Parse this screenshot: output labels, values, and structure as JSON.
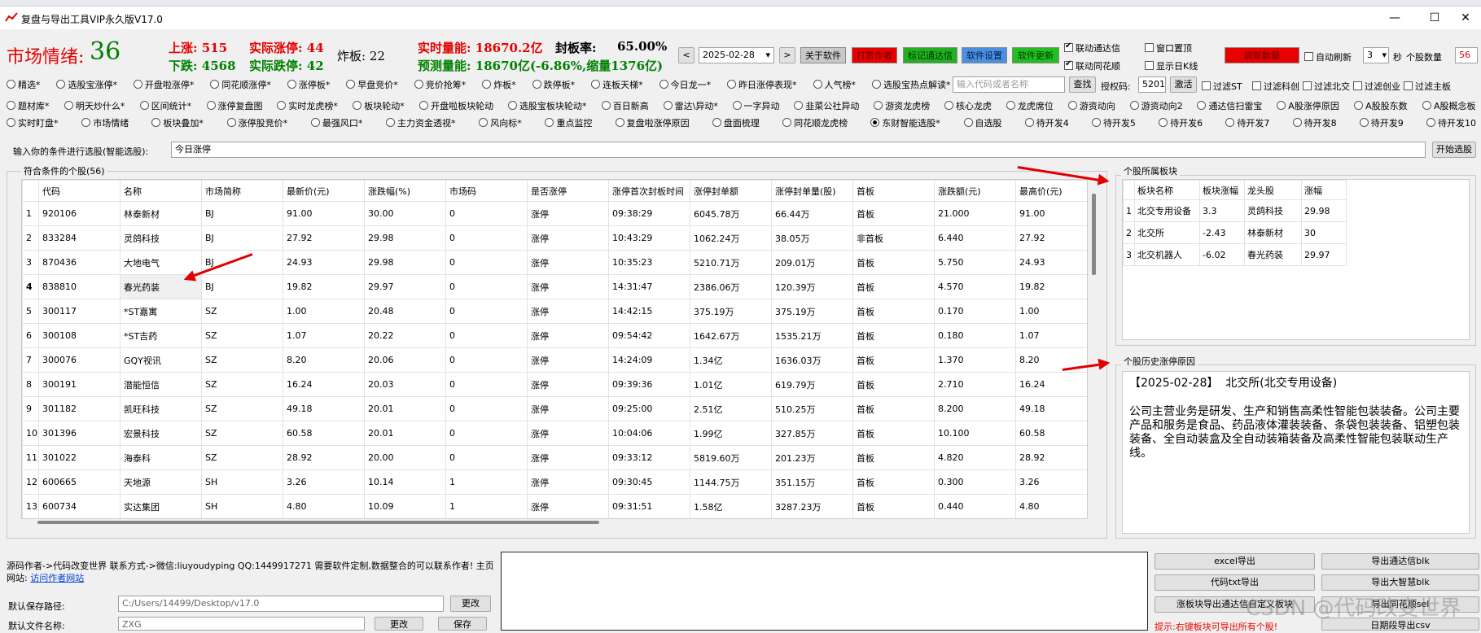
{
  "window": {
    "title": "复盘与导出工具VIP永久版V17.0",
    "minimize": "—",
    "maximize": "☐",
    "close": "✕"
  },
  "stats": {
    "mood_label": "市场情绪:",
    "mood_value": "36",
    "up": "上涨: 515",
    "real_limit_up": "实际涨停: 44",
    "broken": "炸板: 22",
    "realtime_vol": "实时量能: 18670.2亿",
    "seal_rate_label": "封板率:",
    "seal_rate": "65.00%",
    "down": "下跌: 4568",
    "real_limit_down": "实际跌停: 42",
    "forecast_vol": "预测量能: 18670亿(-6.86%,缩量1376亿)"
  },
  "toolbar": {
    "prev": "<",
    "date": "2025-02-28",
    "next": ">",
    "about": "关于软件",
    "donate": "打赏作者",
    "mark_tdx": "标记通达信",
    "settings": "软件设置",
    "update": "软件更新",
    "link_tdx": "联动通达信",
    "link_ths": "联动同花顺",
    "pin_window": "窗口置顶",
    "show_kline": "显示日K线",
    "refresh": "刷新数据",
    "auto_refresh": "自动刷新",
    "interval": "3",
    "seconds": "秒",
    "stock_count_label": "个股数量",
    "stock_count": "56"
  },
  "radio_rows": [
    [
      "精选*",
      "选股宝涨停*",
      "开盘啦涨停*",
      "同花顺涨停*",
      "涨停板*",
      "早盘竞价*",
      "竞价抢筹*",
      "炸板*",
      "跌停板*",
      "连板天梯*",
      "今日龙一*",
      "昨日涨停表现*",
      "人气榜*",
      "选股宝热点解读*"
    ],
    [
      "题材库*",
      "明天炒什么*",
      "区间统计*",
      "涨停复盘图",
      "实时龙虎榜*",
      "板块轮动*",
      "开盘啦板块轮动",
      "选股宝板块轮动*",
      "百日新高",
      "雷达\\异动*",
      "一字异动",
      "韭菜公社异动",
      "游资龙虎榜",
      "核心龙虎",
      "龙虎席位",
      "游资动向",
      "游资动向2",
      "通达信扫雷宝",
      "A股涨停原因",
      "A股股东数",
      "A股概念板"
    ],
    [
      "实时盯盘*",
      "市场情绪",
      "板块叠加*",
      "涨停股竞价*",
      "最强风口*",
      "主力资金透视*",
      "风向标*",
      "重点监控",
      "复盘啦涨停原因",
      "盘面梳理",
      "同花顺龙虎榜",
      "东财智能选股*",
      "自选股",
      "待开发4",
      "待开发5",
      "待开发6",
      "待开发7",
      "待开发8",
      "待开发9",
      "待开发10"
    ]
  ],
  "search": {
    "placeholder": "输入代码或者名称",
    "button": "查找",
    "auth_label": "授权码:",
    "auth_code": "5201",
    "activate": "激活",
    "filters": [
      "过滤ST",
      "过滤科创",
      "过滤北交",
      "过滤创业",
      "过滤主板"
    ]
  },
  "condition": {
    "label": "输入你的条件进行选股(智能选股):",
    "value": "今日涨停",
    "button": "开始选股"
  },
  "main_table": {
    "title": "符合条件的个股(56)",
    "headers": [
      "代码",
      "名称",
      "市场简称",
      "最新价(元)",
      "涨跌幅(%)",
      "市场码",
      "是否涨停",
      "涨停首次封板时间",
      "涨停封单额",
      "涨停封单量(股)",
      "首板",
      "涨跌额(元)",
      "最高价(元)"
    ],
    "rows": [
      [
        "1",
        "920106",
        "林泰新材",
        "BJ",
        "91.00",
        "30.00",
        "0",
        "涨停",
        "09:38:29",
        "6045.78万",
        "66.44万",
        "首板",
        "21.000",
        "91.00"
      ],
      [
        "2",
        "833284",
        "灵鸽科技",
        "BJ",
        "27.92",
        "29.98",
        "0",
        "涨停",
        "10:43:29",
        "1062.24万",
        "38.05万",
        "非首板",
        "6.440",
        "27.92"
      ],
      [
        "3",
        "870436",
        "大地电气",
        "BJ",
        "24.93",
        "29.98",
        "0",
        "涨停",
        "10:35:23",
        "5210.71万",
        "209.01万",
        "首板",
        "5.750",
        "24.93"
      ],
      [
        "4",
        "838810",
        "春光药装",
        "BJ",
        "19.82",
        "29.97",
        "0",
        "涨停",
        "14:31:47",
        "2386.06万",
        "120.39万",
        "首板",
        "4.570",
        "19.82"
      ],
      [
        "5",
        "300117",
        "*ST嘉寓",
        "SZ",
        "1.00",
        "20.48",
        "0",
        "涨停",
        "14:42:15",
        "375.19万",
        "375.19万",
        "首板",
        "0.170",
        "1.00"
      ],
      [
        "6",
        "300108",
        "*ST吉药",
        "SZ",
        "1.07",
        "20.22",
        "0",
        "涨停",
        "09:54:42",
        "1642.67万",
        "1535.21万",
        "首板",
        "0.180",
        "1.07"
      ],
      [
        "7",
        "300076",
        "GQY视讯",
        "SZ",
        "8.20",
        "20.06",
        "0",
        "涨停",
        "14:24:09",
        "1.34亿",
        "1636.03万",
        "首板",
        "1.370",
        "8.20"
      ],
      [
        "8",
        "300191",
        "潜能恒信",
        "SZ",
        "16.24",
        "20.03",
        "0",
        "涨停",
        "09:39:36",
        "1.01亿",
        "619.79万",
        "首板",
        "2.710",
        "16.24"
      ],
      [
        "9",
        "301182",
        "凯旺科技",
        "SZ",
        "49.18",
        "20.01",
        "0",
        "涨停",
        "09:25:00",
        "2.51亿",
        "510.25万",
        "首板",
        "8.200",
        "49.18"
      ],
      [
        "10",
        "301396",
        "宏景科技",
        "SZ",
        "60.58",
        "20.01",
        "0",
        "涨停",
        "10:04:06",
        "1.99亿",
        "327.85万",
        "首板",
        "10.100",
        "60.58"
      ],
      [
        "11",
        "301022",
        "海泰科",
        "SZ",
        "28.92",
        "20.00",
        "0",
        "涨停",
        "09:33:12",
        "5819.60万",
        "201.23万",
        "首板",
        "4.820",
        "28.92"
      ],
      [
        "12",
        "600665",
        "天地源",
        "SH",
        "3.26",
        "10.14",
        "1",
        "涨停",
        "09:30:45",
        "1144.75万",
        "351.15万",
        "首板",
        "0.300",
        "3.26"
      ],
      [
        "13",
        "600734",
        "实达集团",
        "SH",
        "4.80",
        "10.09",
        "1",
        "涨停",
        "09:31:51",
        "1.58亿",
        "3287.23万",
        "首板",
        "0.440",
        "4.80"
      ]
    ]
  },
  "sector_table": {
    "title": "个股所属板块",
    "headers": [
      "板块名称",
      "板块涨幅",
      "龙头股",
      "涨幅"
    ],
    "rows": [
      [
        "1",
        "北交专用设备",
        "3.3",
        "灵鸽科技",
        "29.98"
      ],
      [
        "2",
        "北交所",
        "-2.43",
        "林泰新材",
        "30"
      ],
      [
        "3",
        "北交机器人",
        "-6.02",
        "春光药装",
        "29.97"
      ]
    ]
  },
  "history": {
    "title": "个股历史涨停原因",
    "line1": "【2025-02-28】  北交所(北交专用设备)",
    "para": "公司主营业务是研发、生产和销售高柔性智能包装装备。公司主要产品和服务是食品、药品液体灌装装备、条袋包装装备、铝塑包装装备、全自动装盒及全自动装箱装备及高柔性智能包装联动生产线。"
  },
  "footer": {
    "author": "源码作者->代码改变世界 联系方式->微信:liuyoudyping QQ:1449917271 需要软件定制,数据整合的可以联系作者! 主页网站:",
    "site_link": "访问作者网站",
    "save_path_label": "默认保存路径:",
    "save_path": "C:/Users/14499/Desktop/v17.0",
    "change": "更改",
    "file_name_label": "默认文件名称:",
    "file_name": "ZXG",
    "change2": "更改",
    "save": "保存",
    "export": [
      "excel导出",
      "导出通达信blk",
      "代码txt导出",
      "导出大智慧blk",
      "涨板块导出通达信自定义板块",
      "导出同花顺sel",
      "日期段导出csv"
    ],
    "tip": "提示:右键板块可导出所有个股!",
    "watermark": "CSDN @代码改变世界"
  }
}
